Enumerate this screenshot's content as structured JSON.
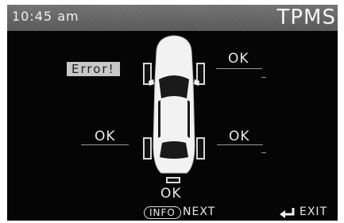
{
  "header": {
    "clock": "10:45 am",
    "title": "TPMS"
  },
  "tires": {
    "front_left": {
      "status": "Error!",
      "state": "error"
    },
    "front_right": {
      "status": "OK",
      "state": "ok"
    },
    "rear_left": {
      "status": "OK",
      "state": "ok"
    },
    "rear_right": {
      "status": "OK",
      "state": "ok"
    },
    "spare": {
      "status": "OK",
      "state": "ok"
    }
  },
  "footer": {
    "info_label": "INFO",
    "next_label": "NEXT",
    "exit_label": "EXIT",
    "exit_icon": "enter-return-icon"
  },
  "colors": {
    "screen_bg": "#050505",
    "header_bg": "#666666",
    "text": "#e8e8e8",
    "error_bg": "#c8c8c8"
  }
}
